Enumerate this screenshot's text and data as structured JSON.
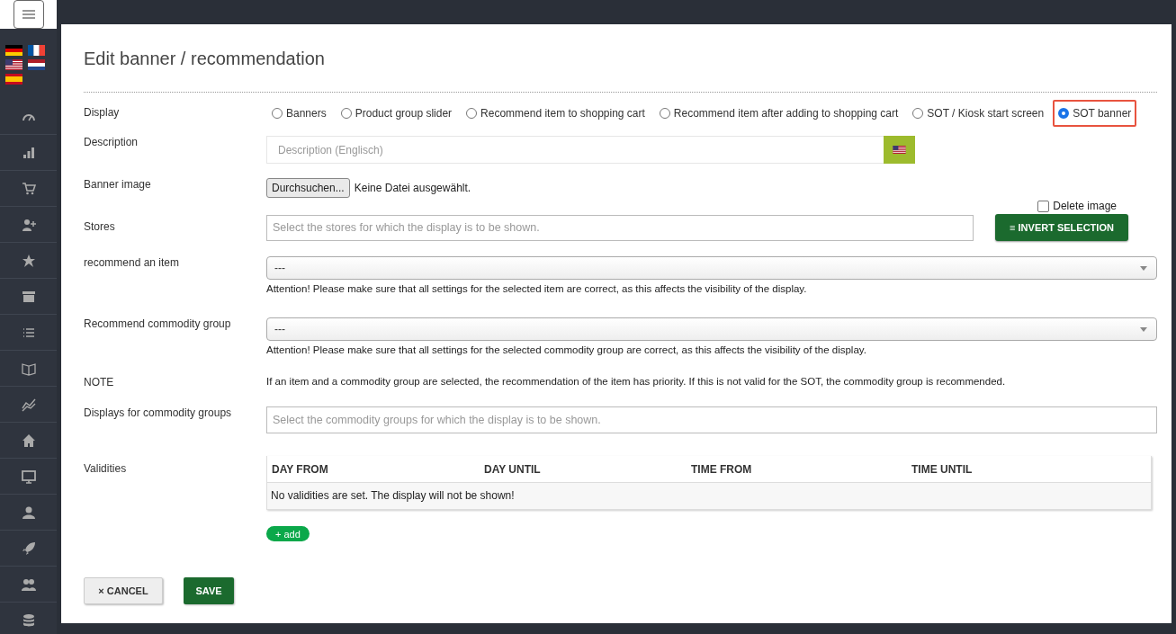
{
  "page": {
    "title": "Edit banner / recommendation"
  },
  "display": {
    "label": "Display",
    "options": [
      {
        "label": "Banners",
        "selected": false
      },
      {
        "label": "Product group slider",
        "selected": false
      },
      {
        "label": "Recommend item to shopping cart",
        "selected": false
      },
      {
        "label": "Recommend item after adding to shopping cart",
        "selected": false
      },
      {
        "label": "SOT / Kiosk start screen",
        "selected": false
      },
      {
        "label": "SOT banner",
        "selected": true
      }
    ]
  },
  "description": {
    "label": "Description",
    "placeholder": "Description (Englisch)"
  },
  "banner_image": {
    "label": "Banner image",
    "button": "Durchsuchen...",
    "file_status": "Keine Datei ausgewählt.",
    "delete_label": "Delete image",
    "delete_checked": false
  },
  "stores": {
    "label": "Stores",
    "placeholder": "Select the stores for which the display is to be shown.",
    "button": "≡ INVERT SELECTION"
  },
  "recommend_item": {
    "label": "recommend an item",
    "value": "---",
    "hint": "Attention! Please make sure that all settings for the selected item are correct, as this affects the visibility of the display."
  },
  "recommend_group": {
    "label": "Recommend commodity group",
    "value": "---",
    "hint": "Attention! Please make sure that all settings for the selected commodity group are correct, as this affects the visibility of the display."
  },
  "note": {
    "label": "NOTE",
    "text": "If an item and a commodity group are selected, the recommendation of the item has priority. If this is not valid for the SOT, the commodity group is recommended."
  },
  "commodity_groups": {
    "label": "Displays for commodity groups",
    "placeholder": "Select the commodity groups for which the display is to be shown."
  },
  "validities": {
    "label": "Validities",
    "columns": [
      "DAY FROM",
      "DAY UNTIL",
      "TIME FROM",
      "TIME UNTIL"
    ],
    "empty": "No validities are set. The display will not be shown!",
    "add": "+ add"
  },
  "buttons": {
    "cancel": "× CANCEL",
    "save": "SAVE"
  }
}
